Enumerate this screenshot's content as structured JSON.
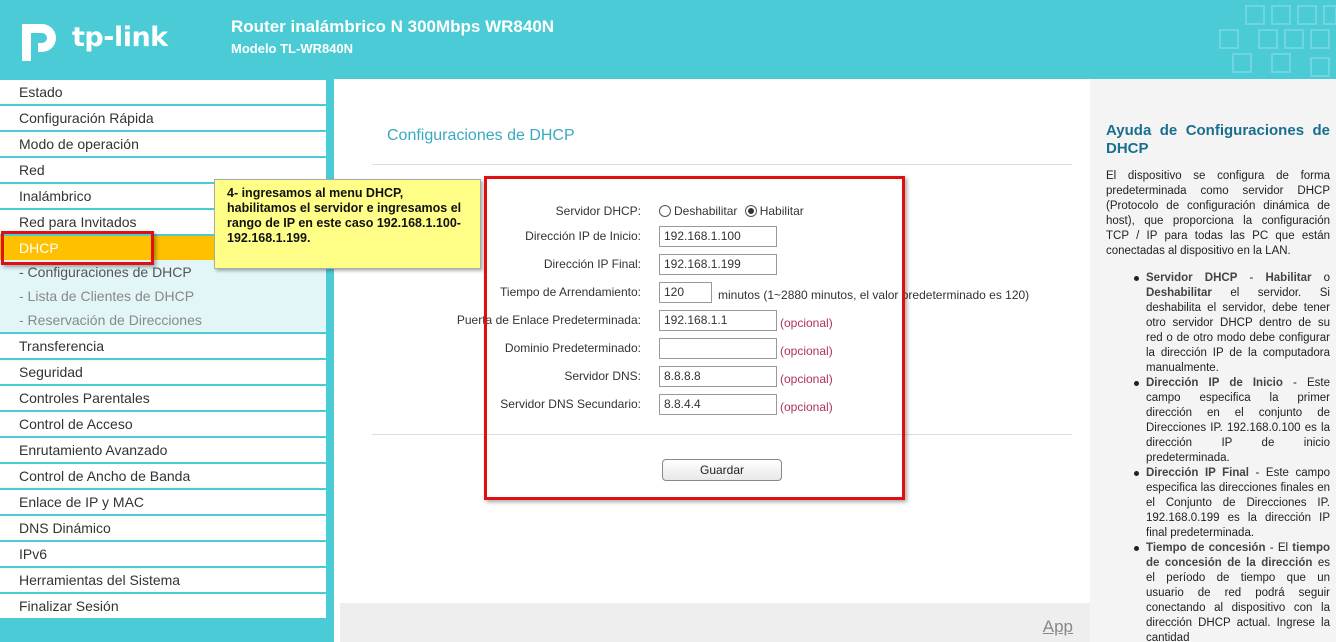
{
  "header": {
    "logo_text": "tp-link",
    "title": "Router inalámbrico N 300Mbps WR840N",
    "model": "Modelo TL-WR840N"
  },
  "sidebar": {
    "items": [
      "Estado",
      "Configuración Rápida",
      "Modo de operación",
      "Red",
      "Inalámbrico",
      "Red para Invitados",
      "DHCP",
      "Transferencia",
      "Seguridad",
      "Controles Parentales",
      "Control de Acceso",
      "Enrutamiento Avanzado",
      "Control de Ancho de Banda",
      "Enlace de IP y MAC",
      "DNS Dinámico",
      "IPv6",
      "Herramientas del Sistema",
      "Finalizar Sesión"
    ],
    "dhcp_sub": [
      "- Configuraciones de DHCP",
      "- Lista de Clientes de DHCP",
      "- Reservación de Direcciones"
    ],
    "active": "DHCP"
  },
  "main": {
    "title": "Configuraciones de DHCP",
    "server_label": "Servidor DHCP:",
    "disable_label": "Deshabilitar",
    "enable_label": "Habilitar",
    "start_ip_label": "Dirección IP de Inicio:",
    "start_ip": "192.168.1.100",
    "end_ip_label": "Dirección IP Final:",
    "end_ip": "192.168.1.199",
    "lease_label": "Tiempo de Arrendamiento:",
    "lease": "120",
    "lease_hint": "minutos (1~2880 minutos, el valor predeterminado es 120)",
    "gateway_label": "Puerta de Enlace Predeterminada:",
    "gateway": "192.168.1.1",
    "domain_label": "Dominio Predeterminado:",
    "domain": "",
    "dns_label": "Servidor DNS:",
    "dns": "8.8.8.8",
    "dns2_label": "Servidor DNS Secundario:",
    "dns2": "8.8.4.4",
    "optional": "(opcional)",
    "save": "Guardar",
    "app_link": "App"
  },
  "annotation": {
    "note_text": "4- ingresamos al menu DHCP, habilitamos el servidor e ingresamos el rango de IP en este caso 192.168.1.100-192.168.1.199.",
    "color": "#e01010"
  },
  "help": {
    "title": "Ayuda de Configuraciones de DHCP",
    "intro": "El dispositivo se configura de forma predeterminada como servidor DHCP (Protocolo de configuración dinámica de host), que proporciona la configuración TCP / IP para todas las PC que están conectadas al dispositivo en la LAN.",
    "items": [
      {
        "b1": "Servidor DHCP",
        "t1": " - ",
        "b2": "Habilitar",
        "t2": " o ",
        "b3": "Deshabilitar",
        "t3": " el servidor. Si deshabilita el servidor, debe tener otro servidor DHCP dentro de su red o de otro modo debe configurar la dirección IP de la computadora manualmente."
      },
      {
        "b1": "Dirección IP de Inicio",
        "t1": " - Este campo especifica la primer dirección en el conjunto de Direcciones IP. 192.168.0.100 es la dirección IP de inicio predeterminada.",
        "b2": "",
        "t2": "",
        "b3": "",
        "t3": ""
      },
      {
        "b1": "Dirección IP Final",
        "t1": " - Este campo especifica las direcciones finales en el Conjunto de Direcciones IP. 192.168.0.199 es la dirección IP final predeterminada.",
        "b2": "",
        "t2": "",
        "b3": "",
        "t3": ""
      },
      {
        "b1": "Tiempo de concesión",
        "t1": " - El ",
        "b2": "tiempo de concesión de la dirección",
        "t2": " es el período de tiempo que un usuario de red podrá seguir conectando al dispositivo con la dirección DHCP actual. Ingrese la cantidad",
        "b3": "",
        "t3": ""
      }
    ]
  }
}
